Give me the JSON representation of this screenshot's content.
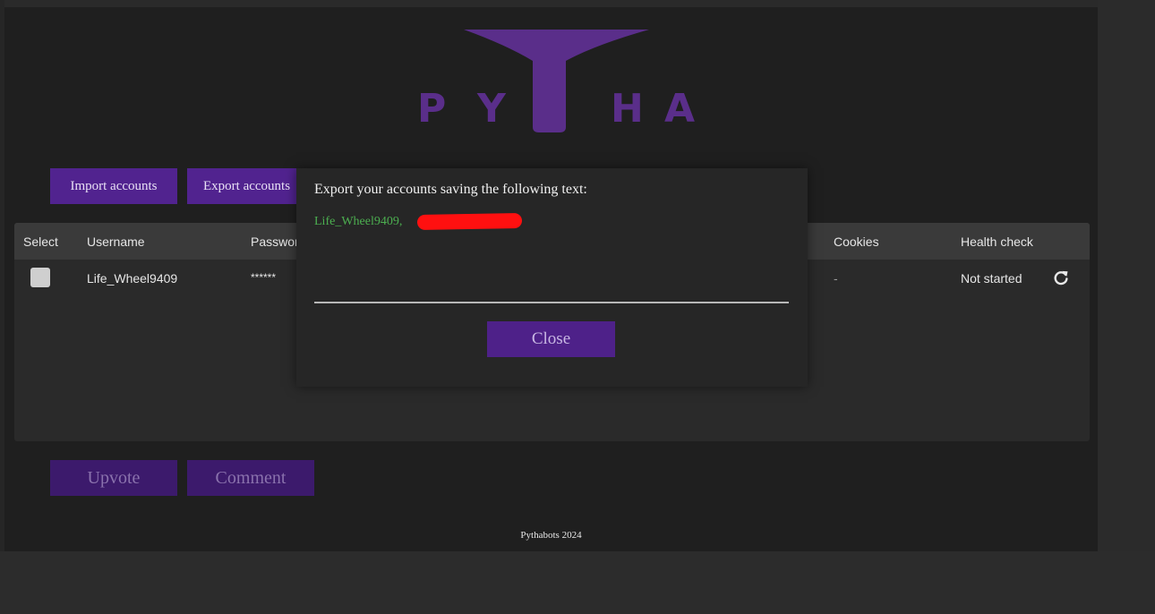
{
  "logo": {
    "letters": [
      "P",
      "Y",
      "H",
      "A"
    ],
    "icon": "whale-tail-icon",
    "color": "#5a2e8a"
  },
  "toolbar": {
    "import_label": "Import accounts",
    "export_label": "Export accounts"
  },
  "table": {
    "headers": {
      "select": "Select",
      "username": "Username",
      "password": "Passwor",
      "cookies": "Cookies",
      "health": "Health check"
    },
    "rows": [
      {
        "username": "Life_Wheel9409",
        "password": "******",
        "cookies": "-",
        "health": "Not started",
        "refresh_icon": "refresh-icon"
      }
    ]
  },
  "modal": {
    "title": "Export your accounts saving the following text:",
    "export_text": "Life_Wheel9409,",
    "close_label": "Close"
  },
  "actions": {
    "upvote_label": "Upvote",
    "comment_label": "Comment"
  },
  "footer": {
    "text": "Pythabots 2024"
  },
  "colors": {
    "accent": "#51238f",
    "success_text": "#4caf50"
  }
}
